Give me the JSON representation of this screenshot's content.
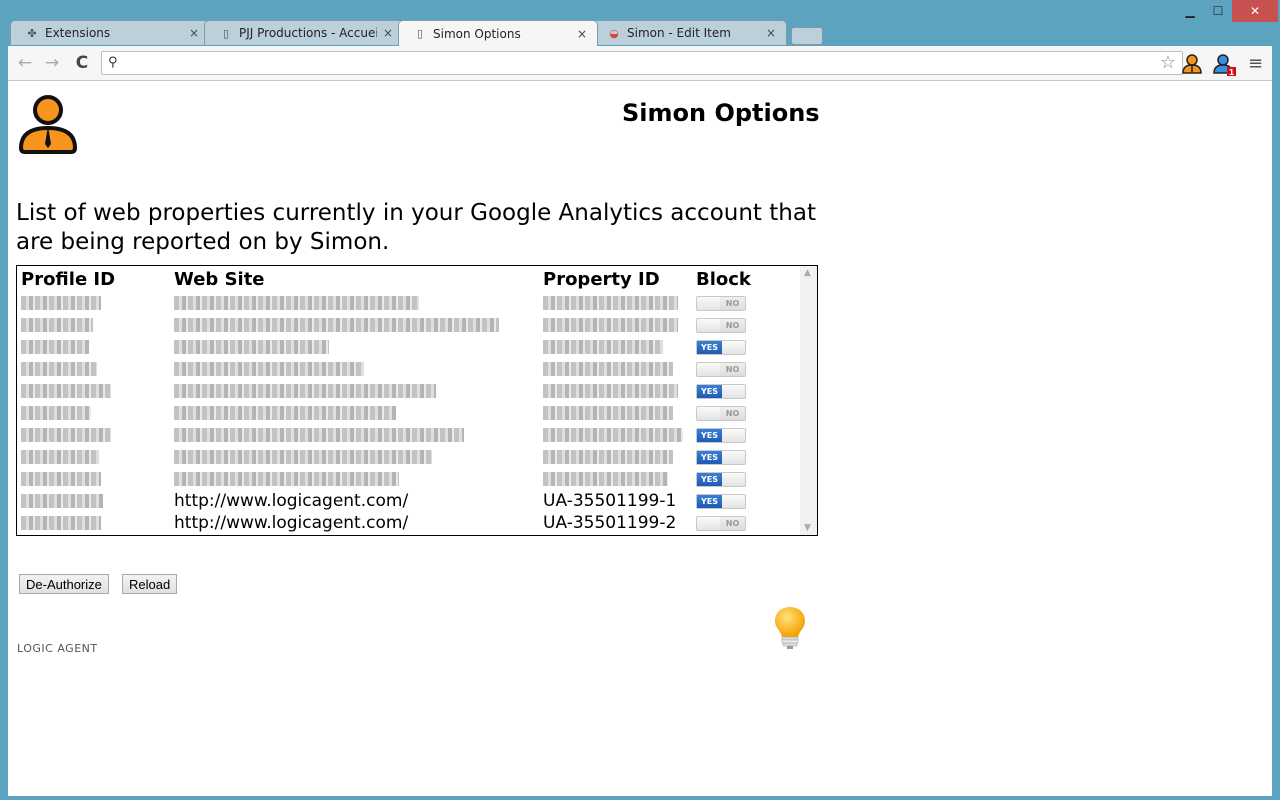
{
  "window": {
    "minimize": "▁",
    "maximize": "☐",
    "close": "✕"
  },
  "tabs": [
    {
      "label": "Extensions",
      "icon": "puzzle-icon",
      "active": false
    },
    {
      "label": "PJJ Productions - Accueil",
      "icon": "page-icon",
      "active": false
    },
    {
      "label": "Simon Options",
      "icon": "page-icon",
      "active": true
    },
    {
      "label": "Simon - Edit Item",
      "icon": "chrome-store-icon",
      "active": false
    }
  ],
  "tab_close": "×",
  "toolbar": {
    "back": "←",
    "forward": "→",
    "reload": "C",
    "omnibox_value": "",
    "omnibox_placeholder": "",
    "star": "☆",
    "menu": "≡",
    "ext_badge": "1"
  },
  "page": {
    "title": "Simon Options",
    "intro": "List of web properties currently in your Google Analytics account that are being reported on by Simon.",
    "table": {
      "headers": [
        "Profile ID",
        "Web Site",
        "Property ID",
        "Block"
      ],
      "rows": [
        {
          "profile": "[obscured]",
          "site": "[obscured]",
          "property": "[obscured]",
          "block": "NO"
        },
        {
          "profile": "[obscured]",
          "site": "[obscured]",
          "property": "[obscured]",
          "block": "NO"
        },
        {
          "profile": "[obscured]",
          "site": "[obscured]",
          "property": "[obscured]",
          "block": "YES"
        },
        {
          "profile": "[obscured]",
          "site": "[obscured]",
          "property": "[obscured]",
          "block": "NO"
        },
        {
          "profile": "[obscured]",
          "site": "[obscured]",
          "property": "[obscured]",
          "block": "YES"
        },
        {
          "profile": "[obscured]",
          "site": "[obscured]",
          "property": "[obscured]",
          "block": "NO"
        },
        {
          "profile": "[obscured]",
          "site": "[obscured]",
          "property": "[obscured]",
          "block": "YES"
        },
        {
          "profile": "[obscured]",
          "site": "[obscured]",
          "property": "[obscured]",
          "block": "YES"
        },
        {
          "profile": "[obscured]",
          "site": "[obscured]",
          "property": "[obscured]",
          "block": "YES"
        },
        {
          "profile": "[obscured]",
          "site": "http://www.logicagent.com/",
          "property": "UA-35501199-1",
          "block": "YES"
        },
        {
          "profile": "[obscured]",
          "site": "http://www.logicagent.com/",
          "property": "UA-35501199-2",
          "block": "NO"
        }
      ]
    },
    "buttons": {
      "deauthorize": "De-Authorize",
      "reload": "Reload"
    },
    "footer_logo": "LOGIC AGENT",
    "colors": {
      "accent_orange": "#f7941d",
      "toggle_blue": "#1d5bb5",
      "chrome_frame": "#5ba3bf"
    }
  }
}
